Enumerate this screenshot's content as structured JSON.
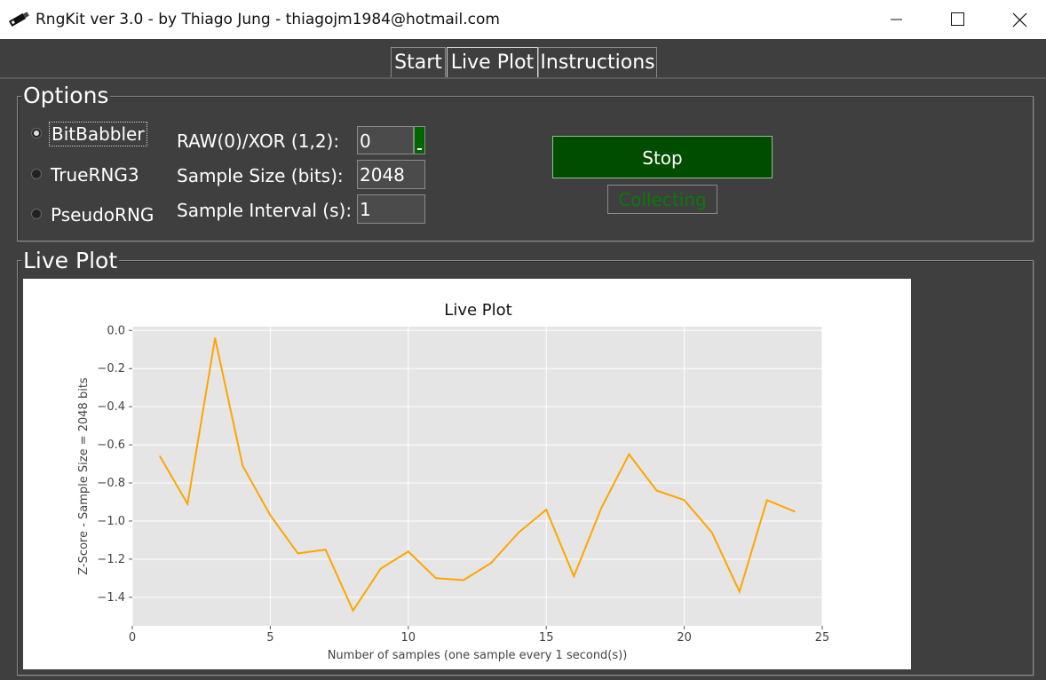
{
  "window": {
    "title": "RngKit ver 3.0 - by Thiago Jung - thiagojm1984@hotmail.com",
    "app_icon": "usb-stick-icon"
  },
  "tabs": [
    {
      "label": "Start"
    },
    {
      "label": "Live Plot",
      "selected": true
    },
    {
      "label": "Instructions"
    }
  ],
  "options": {
    "title": "Options",
    "devices": [
      {
        "label": "BitBabbler",
        "checked": true
      },
      {
        "label": "TrueRNG3",
        "checked": false
      },
      {
        "label": "PseudoRNG",
        "checked": false
      }
    ],
    "raw_xor": {
      "label": "RAW(0)/XOR (1,2):",
      "value": "0"
    },
    "sample_size": {
      "label": "Sample Size (bits):",
      "value": "2048"
    },
    "sample_interval": {
      "label": "Sample Interval (s):",
      "value": "1"
    },
    "stop_label": "Stop",
    "status": "Collecting"
  },
  "live_plot": {
    "title": "Live Plot"
  },
  "colors": {
    "background": "#3f3f3f",
    "stop_button": "#004d00",
    "status_text": "#0a7a0a",
    "line": "#ffa500",
    "plot_bg": "#e5e5e5"
  },
  "chart_data": {
    "type": "line",
    "title": "Live Plot",
    "xlabel": "Number of samples (one sample every 1 second(s))",
    "ylabel": "Z-Score - Sample Size = 2048 bits",
    "xlim": [
      0,
      25
    ],
    "ylim": [
      -1.55,
      0.02
    ],
    "xticks": [
      "0",
      "5",
      "10",
      "15",
      "20",
      "25"
    ],
    "xtick_values": [
      0,
      5,
      10,
      15,
      20,
      25
    ],
    "yticks": [
      "0.0",
      "−0.2",
      "−0.4",
      "−0.6",
      "−0.8",
      "−1.0",
      "−1.2",
      "−1.4"
    ],
    "ytick_values": [
      0,
      -0.2,
      -0.4,
      -0.6,
      -0.8,
      -1.0,
      -1.2,
      -1.4
    ],
    "grid": true,
    "series": [
      {
        "x": [
          1,
          2,
          3,
          4,
          5,
          6,
          7,
          8,
          9,
          10,
          11,
          12,
          13,
          14,
          15,
          16,
          17,
          18,
          19,
          20,
          21,
          22,
          23,
          24
        ],
        "values": [
          -0.66,
          -0.91,
          -0.04,
          -0.71,
          -0.97,
          -1.17,
          -1.15,
          -1.47,
          -1.25,
          -1.16,
          -1.3,
          -1.31,
          -1.22,
          -1.06,
          -0.94,
          -1.29,
          -0.93,
          -0.65,
          -0.84,
          -0.89,
          -1.06,
          -1.37,
          -0.89,
          -0.95
        ]
      }
    ]
  }
}
